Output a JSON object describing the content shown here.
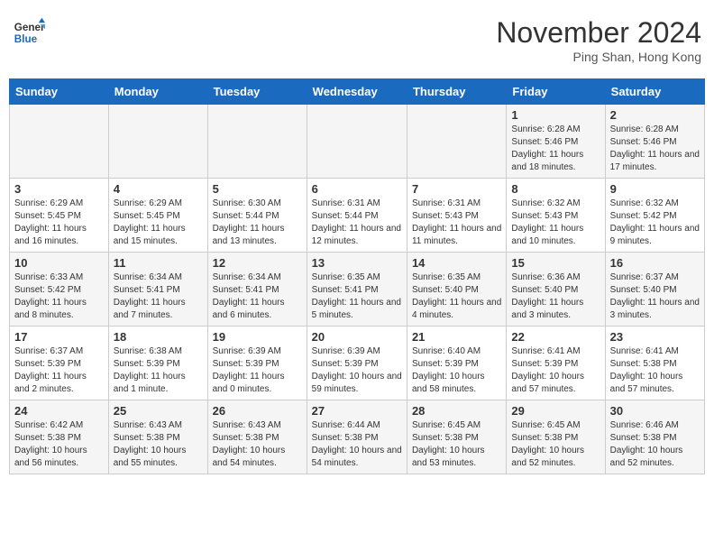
{
  "header": {
    "logo_line1": "General",
    "logo_line2": "Blue",
    "month": "November 2024",
    "location": "Ping Shan, Hong Kong"
  },
  "weekdays": [
    "Sunday",
    "Monday",
    "Tuesday",
    "Wednesday",
    "Thursday",
    "Friday",
    "Saturday"
  ],
  "weeks": [
    [
      {
        "day": "",
        "content": ""
      },
      {
        "day": "",
        "content": ""
      },
      {
        "day": "",
        "content": ""
      },
      {
        "day": "",
        "content": ""
      },
      {
        "day": "",
        "content": ""
      },
      {
        "day": "1",
        "content": "Sunrise: 6:28 AM\nSunset: 5:46 PM\nDaylight: 11 hours and 18 minutes."
      },
      {
        "day": "2",
        "content": "Sunrise: 6:28 AM\nSunset: 5:46 PM\nDaylight: 11 hours and 17 minutes."
      }
    ],
    [
      {
        "day": "3",
        "content": "Sunrise: 6:29 AM\nSunset: 5:45 PM\nDaylight: 11 hours and 16 minutes."
      },
      {
        "day": "4",
        "content": "Sunrise: 6:29 AM\nSunset: 5:45 PM\nDaylight: 11 hours and 15 minutes."
      },
      {
        "day": "5",
        "content": "Sunrise: 6:30 AM\nSunset: 5:44 PM\nDaylight: 11 hours and 13 minutes."
      },
      {
        "day": "6",
        "content": "Sunrise: 6:31 AM\nSunset: 5:44 PM\nDaylight: 11 hours and 12 minutes."
      },
      {
        "day": "7",
        "content": "Sunrise: 6:31 AM\nSunset: 5:43 PM\nDaylight: 11 hours and 11 minutes."
      },
      {
        "day": "8",
        "content": "Sunrise: 6:32 AM\nSunset: 5:43 PM\nDaylight: 11 hours and 10 minutes."
      },
      {
        "day": "9",
        "content": "Sunrise: 6:32 AM\nSunset: 5:42 PM\nDaylight: 11 hours and 9 minutes."
      }
    ],
    [
      {
        "day": "10",
        "content": "Sunrise: 6:33 AM\nSunset: 5:42 PM\nDaylight: 11 hours and 8 minutes."
      },
      {
        "day": "11",
        "content": "Sunrise: 6:34 AM\nSunset: 5:41 PM\nDaylight: 11 hours and 7 minutes."
      },
      {
        "day": "12",
        "content": "Sunrise: 6:34 AM\nSunset: 5:41 PM\nDaylight: 11 hours and 6 minutes."
      },
      {
        "day": "13",
        "content": "Sunrise: 6:35 AM\nSunset: 5:41 PM\nDaylight: 11 hours and 5 minutes."
      },
      {
        "day": "14",
        "content": "Sunrise: 6:35 AM\nSunset: 5:40 PM\nDaylight: 11 hours and 4 minutes."
      },
      {
        "day": "15",
        "content": "Sunrise: 6:36 AM\nSunset: 5:40 PM\nDaylight: 11 hours and 3 minutes."
      },
      {
        "day": "16",
        "content": "Sunrise: 6:37 AM\nSunset: 5:40 PM\nDaylight: 11 hours and 3 minutes."
      }
    ],
    [
      {
        "day": "17",
        "content": "Sunrise: 6:37 AM\nSunset: 5:39 PM\nDaylight: 11 hours and 2 minutes."
      },
      {
        "day": "18",
        "content": "Sunrise: 6:38 AM\nSunset: 5:39 PM\nDaylight: 11 hours and 1 minute."
      },
      {
        "day": "19",
        "content": "Sunrise: 6:39 AM\nSunset: 5:39 PM\nDaylight: 11 hours and 0 minutes."
      },
      {
        "day": "20",
        "content": "Sunrise: 6:39 AM\nSunset: 5:39 PM\nDaylight: 10 hours and 59 minutes."
      },
      {
        "day": "21",
        "content": "Sunrise: 6:40 AM\nSunset: 5:39 PM\nDaylight: 10 hours and 58 minutes."
      },
      {
        "day": "22",
        "content": "Sunrise: 6:41 AM\nSunset: 5:39 PM\nDaylight: 10 hours and 57 minutes."
      },
      {
        "day": "23",
        "content": "Sunrise: 6:41 AM\nSunset: 5:38 PM\nDaylight: 10 hours and 57 minutes."
      }
    ],
    [
      {
        "day": "24",
        "content": "Sunrise: 6:42 AM\nSunset: 5:38 PM\nDaylight: 10 hours and 56 minutes."
      },
      {
        "day": "25",
        "content": "Sunrise: 6:43 AM\nSunset: 5:38 PM\nDaylight: 10 hours and 55 minutes."
      },
      {
        "day": "26",
        "content": "Sunrise: 6:43 AM\nSunset: 5:38 PM\nDaylight: 10 hours and 54 minutes."
      },
      {
        "day": "27",
        "content": "Sunrise: 6:44 AM\nSunset: 5:38 PM\nDaylight: 10 hours and 54 minutes."
      },
      {
        "day": "28",
        "content": "Sunrise: 6:45 AM\nSunset: 5:38 PM\nDaylight: 10 hours and 53 minutes."
      },
      {
        "day": "29",
        "content": "Sunrise: 6:45 AM\nSunset: 5:38 PM\nDaylight: 10 hours and 52 minutes."
      },
      {
        "day": "30",
        "content": "Sunrise: 6:46 AM\nSunset: 5:38 PM\nDaylight: 10 hours and 52 minutes."
      }
    ]
  ]
}
